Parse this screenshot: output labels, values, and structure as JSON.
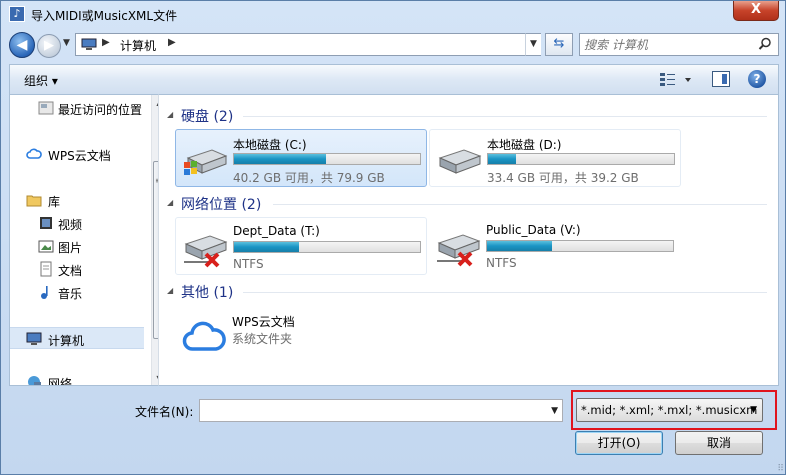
{
  "window": {
    "title": "导入MIDI或MusicXML文件",
    "title_icon": "music-note-icon",
    "close_label": "X"
  },
  "nav": {
    "back_label": "◀",
    "forward_label": "▶",
    "breadcrumb": "计算机",
    "search_placeholder": "搜索 计算机"
  },
  "toolbar": {
    "organize_label": "组织 ▾"
  },
  "sidebar": {
    "items": [
      {
        "label": "最近访问的位置",
        "icon": "recent-places-icon"
      },
      {
        "label": "WPS云文档",
        "icon": "cloud-icon"
      },
      {
        "label": "库",
        "icon": "library-icon"
      },
      {
        "label": "视频",
        "icon": "video-icon"
      },
      {
        "label": "图片",
        "icon": "pictures-icon"
      },
      {
        "label": "文档",
        "icon": "documents-icon"
      },
      {
        "label": "音乐",
        "icon": "music-icon"
      },
      {
        "label": "计算机",
        "icon": "computer-icon"
      },
      {
        "label": "网络",
        "icon": "network-icon"
      }
    ]
  },
  "groups": {
    "hard_disks": "硬盘 (2)",
    "network": "网络位置 (2)",
    "other": "其他 (1)"
  },
  "drives": {
    "c": {
      "name": "本地磁盘 (C:)",
      "info": "40.2 GB 可用，共 79.9 GB",
      "used_fraction": 0.497
    },
    "d": {
      "name": "本地磁盘 (D:)",
      "info": "33.4 GB 可用，共 39.2 GB",
      "used_fraction": 0.148
    },
    "t": {
      "name": "Dept_Data (T:)",
      "info": "NTFS",
      "used_fraction": 0.35
    },
    "v": {
      "name": "Public_Data (V:)",
      "info": "NTFS",
      "used_fraction": 0.35
    },
    "wps": {
      "name": "WPS云文档",
      "info": "系统文件夹"
    }
  },
  "footer": {
    "filename_label": "文件名(N):",
    "filename_value": "",
    "filter_value": "*.mid; *.xml; *.mxl; *.musicxm",
    "open_label": "打开(O)",
    "cancel_label": "取消"
  },
  "colors": {
    "highlight": "#e0141e",
    "group_title": "#1e3287",
    "bar_fill": "#1a94c4"
  }
}
